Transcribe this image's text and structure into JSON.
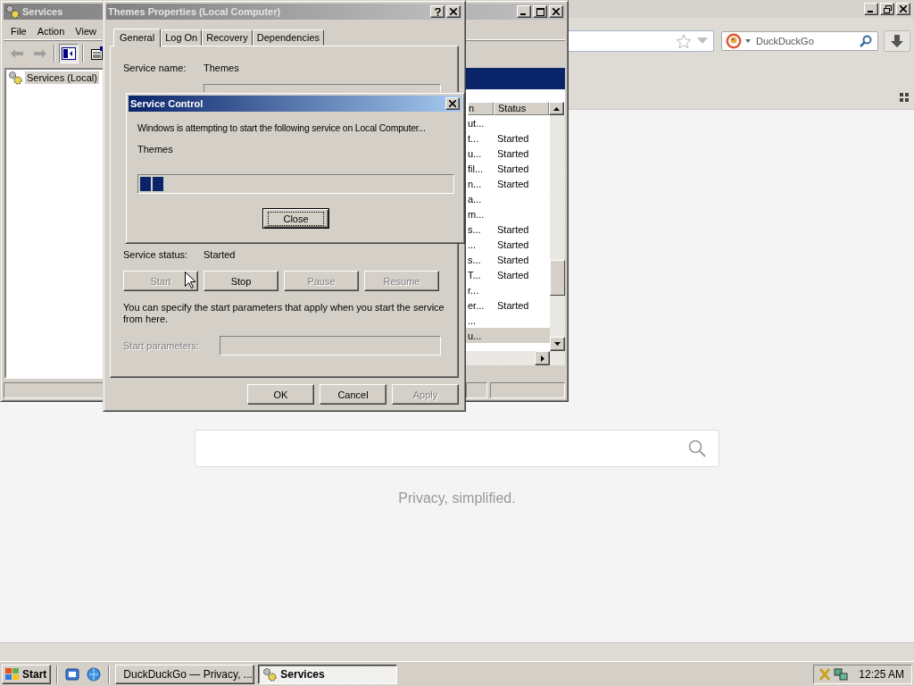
{
  "browser": {
    "search_box": {
      "placeholder": "DuckDuckGo"
    },
    "tagline": "Privacy, simplified."
  },
  "services_window": {
    "title": "Services",
    "menu": [
      "File",
      "Action",
      "View"
    ],
    "tree": [
      {
        "label": "Services (Local)",
        "selected": true
      }
    ],
    "list": {
      "columns": [
        "n",
        "Status"
      ],
      "rows": [
        {
          "column_1": "ut...",
          "selected": false
        },
        {
          "column_1": "t...",
          "status": "Started",
          "selected": false
        },
        {
          "column_1": "u...",
          "status": "Started",
          "selected": false
        },
        {
          "column_1": "fil...",
          "status": "Started",
          "selected": false
        },
        {
          "column_1": "n...",
          "status": "Started",
          "selected": false
        },
        {
          "column_1": "a...",
          "selected": false
        },
        {
          "column_1": "m...",
          "selected": false
        },
        {
          "column_1": "s...",
          "status": "Started",
          "selected": false
        },
        {
          "column_1": "...",
          "status": "Started",
          "selected": false
        },
        {
          "column_1": "s...",
          "status": "Started",
          "selected": false
        },
        {
          "column_1": "T...",
          "status": "Started",
          "selected": false
        },
        {
          "column_1": "r...",
          "selected": false
        },
        {
          "column_1": "er...",
          "status": "Started",
          "selected": false
        },
        {
          "column_1": "...",
          "selected": false
        },
        {
          "column_1": "u...",
          "selected": true
        }
      ]
    }
  },
  "properties_dialog": {
    "title": "Themes Properties (Local Computer)",
    "tabs": [
      {
        "label": "General",
        "selected": true
      },
      {
        "label": "Log On",
        "selected": false
      },
      {
        "label": "Recovery",
        "selected": false
      },
      {
        "label": "Dependencies",
        "selected": false
      }
    ],
    "service_name_label": "Service name:",
    "service_name": "Themes",
    "service_status_label": "Service status:",
    "service_status": "Started",
    "control_buttons": [
      {
        "label": "Start",
        "disabled": true
      },
      {
        "label": "Stop",
        "disabled": false
      },
      {
        "label": "Pause",
        "disabled": true
      },
      {
        "label": "Resume",
        "disabled": true
      }
    ],
    "hint": "You can specify the start parameters that apply when you start the service from here.",
    "start_parameters": {
      "label": "Start parameters:",
      "disabled": true
    },
    "buttons": [
      {
        "label": "OK",
        "disabled": false
      },
      {
        "label": "Cancel",
        "disabled": false
      },
      {
        "label": "Apply",
        "disabled": true
      }
    ]
  },
  "service_control": {
    "title": "Service Control",
    "message": "Windows is attempting to start the following service on Local Computer...",
    "service": "Themes",
    "progress": {
      "level": 0.08
    },
    "button": "Close"
  },
  "taskbar": {
    "start": "Start",
    "tasks": [
      {
        "label": "DuckDuckGo — Privacy, ...",
        "selected": false
      },
      {
        "label": "Services",
        "selected": true
      }
    ],
    "clock": "12:25 AM"
  }
}
